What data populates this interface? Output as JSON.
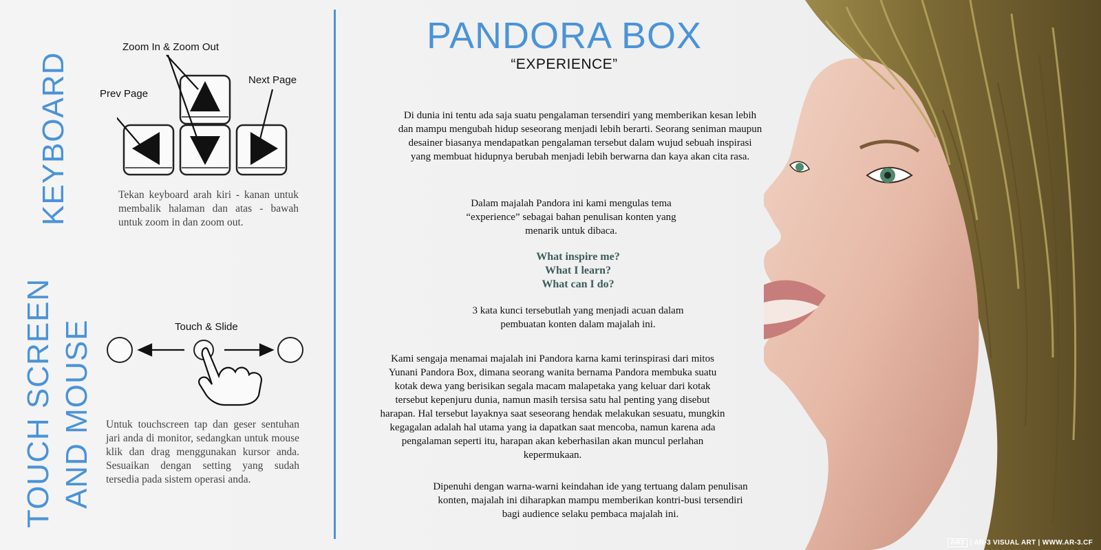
{
  "keyboard": {
    "title": "KEYBOARD",
    "zoom_label": "Zoom In & Zoom Out",
    "prev_label": "Prev Page",
    "next_label": "Next Page",
    "description": "Tekan keyboard arah kiri - kanan untuk membalik halaman dan atas - bawah untuk zoom in dan zoom out."
  },
  "touch": {
    "title_line1": "TOUCH SCREEN",
    "title_line2": "AND MOUSE",
    "gesture_label": "Touch & Slide",
    "description": "Untuk touchscreen tap dan geser sentuhan jari anda di monitor, sedangkan untuk mouse klik dan drag menggunakan kursor anda. Sesuaikan dengan setting yang sudah tersedia pada sistem operasi anda."
  },
  "article": {
    "title": "PANDORA BOX",
    "subtitle": "“EXPERIENCE”",
    "para1": "Di dunia ini tentu ada saja suatu pengalaman tersendiri yang memberikan kesan lebih dan mampu mengubah hidup seseorang menjadi lebih berarti. Seorang seniman maupun desainer biasanya mendapatkan pengalaman tersebut dalam wujud sebuah inspirasi yang membuat hidupnya berubah menjadi lebih berwarna dan kaya akan cita rasa.",
    "para2": "Dalam majalah Pandora ini kami mengulas tema “experience” sebagai bahan penulisan konten yang menarik untuk dibaca.",
    "questions": [
      "What inspire me?",
      "What I learn?",
      "What can I do?"
    ],
    "para3": "3 kata kunci tersebutlah yang menjadi acuan dalam pembuatan konten dalam majalah ini.",
    "para4": "Kami sengaja menamai majalah ini Pandora karna kami terinspirasi dari mitos Yunani Pandora Box, dimana seorang wanita bernama Pandora membuka suatu kotak dewa yang berisikan segala macam malapetaka yang keluar dari kotak tersebut kepenjuru dunia, namun masih tersisa satu hal penting yang disebut harapan. Hal tersebut layaknya saat seseorang hendak melakukan sesuatu, mungkin kegagalan adalah hal utama yang ia dapatkan saat mencoba, namun karena ada pengalaman seperti itu, harapan akan keberhasilan akan muncul perlahan kepermukaan.",
    "para5": "Dipenuhi dengan warna-warni keindahan ide yang tertuang dalam penulisan konten, majalah ini diharapkan mampu memberikan kontri-busi tersendiri bagi audience selaku pembaca majalah ini."
  },
  "footer": {
    "logo": "AR3",
    "text": "| AR-3 VISUAL ART | WWW.AR-3.CF"
  },
  "colors": {
    "accent": "#4a93d9",
    "question": "#3d5a5a"
  }
}
